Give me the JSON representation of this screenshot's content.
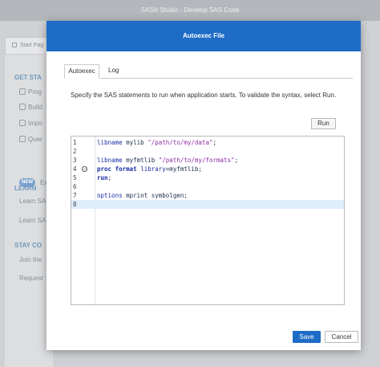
{
  "window": {
    "title": "SAS® Studio - Develop SAS Code"
  },
  "background": {
    "tab_label": "Start Pag",
    "sections": [
      {
        "heading": "GET STA",
        "items": [
          "Prog",
          "Build",
          "Impo",
          "Quer"
        ]
      },
      {
        "heading": "LEARN",
        "items": [
          "Learn SAS",
          "Learn SAS"
        ]
      },
      {
        "heading": "STAY CO",
        "items": [
          "Join the",
          "Request"
        ]
      }
    ],
    "new_badge": "NEW",
    "new_item": "Ex"
  },
  "dialog": {
    "title": "Autoexec File",
    "tabs": [
      {
        "label": "Autoexec",
        "active": true
      },
      {
        "label": "Log",
        "active": false
      }
    ],
    "description": "Specify the SAS statements to run when application starts. To validate the syntax, select Run.",
    "run_label": "Run",
    "editor": {
      "lines": [
        {
          "num": "1",
          "text": "libname mylib \"/path/to/my/data\";"
        },
        {
          "num": "2",
          "text": ""
        },
        {
          "num": "3",
          "text": "libname myfmtlib \"/path/to/my/formats\";"
        },
        {
          "num": "4",
          "text": "proc format library=myfmtlib;",
          "fold_icon": "collapse-circle-icon"
        },
        {
          "num": "5",
          "text": "run;"
        },
        {
          "num": "6",
          "text": ""
        },
        {
          "num": "7",
          "text": "options mprint symbolgen;"
        },
        {
          "num": "8",
          "text": "",
          "current": true
        }
      ]
    },
    "save_label": "Save",
    "cancel_label": "Cancel"
  },
  "colors": {
    "accent": "#1e6cc6",
    "current_line": "#dfeefc",
    "keyword": "#1b2ea8",
    "string": "#8b2ea3"
  }
}
